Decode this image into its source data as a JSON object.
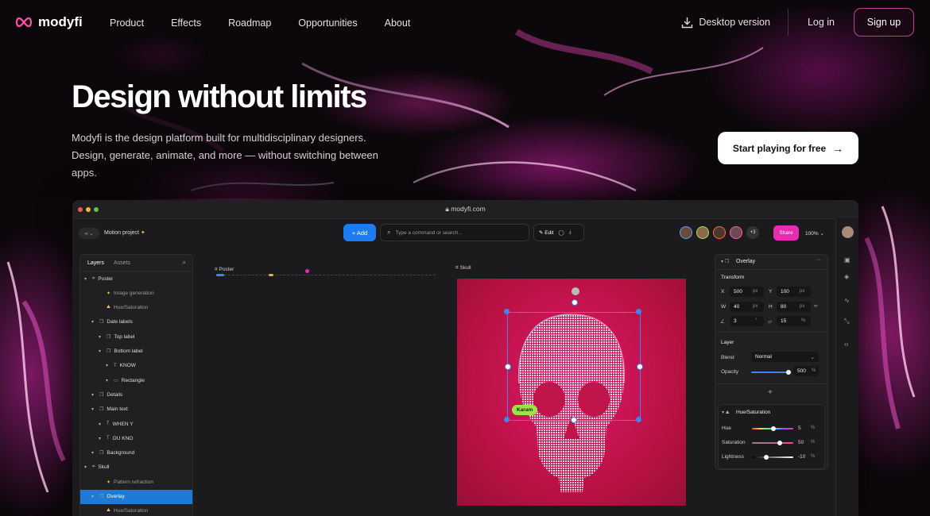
{
  "nav": {
    "brand": "modyfi",
    "menu": [
      "Product",
      "Effects",
      "Roadmap",
      "Opportunities",
      "About"
    ],
    "desktop": "Desktop version",
    "login": "Log in",
    "signup": "Sign up"
  },
  "hero": {
    "title": "Design without limits",
    "subtitle": "Modyfi is the design platform built for multidisciplinary designers. Design, generate, animate, and more — without switching between apps.",
    "cta": "Start playing for free"
  },
  "app": {
    "url": "modyfi.com",
    "project": "Motion project",
    "add": "+ Add",
    "command_placeholder": "Type a command or search...",
    "edit": "Edit",
    "more_users": "+3",
    "share": "Share",
    "zoom": "100%",
    "tabs": [
      "Layers",
      "Assets"
    ],
    "layers": [
      {
        "label": "Poster",
        "indent": 0,
        "icon": "grid"
      },
      {
        "label": "Image generation",
        "indent": 2,
        "icon": "star",
        "dim": true
      },
      {
        "label": "Hue/Saturation",
        "indent": 2,
        "icon": "mountain",
        "dim": true
      },
      {
        "label": "Date labels",
        "indent": 1,
        "icon": "group"
      },
      {
        "label": "Top label",
        "indent": 2,
        "icon": "layers"
      },
      {
        "label": "Bottom label",
        "indent": 2,
        "icon": "layers"
      },
      {
        "label": "KNOW",
        "indent": 3,
        "icon": "text"
      },
      {
        "label": "Rectangle",
        "indent": 3,
        "icon": "rect"
      },
      {
        "label": "Details",
        "indent": 1,
        "icon": "group"
      },
      {
        "label": "Main text",
        "indent": 1,
        "icon": "layers"
      },
      {
        "label": "WHEN Y",
        "indent": 2,
        "icon": "text"
      },
      {
        "label": "OU KNO",
        "indent": 2,
        "icon": "text"
      },
      {
        "label": "Background",
        "indent": 1,
        "icon": "layers"
      },
      {
        "label": "Skull",
        "indent": 0,
        "icon": "grid"
      },
      {
        "label": "Pattern refraction",
        "indent": 2,
        "icon": "star",
        "dim": true
      },
      {
        "label": "Overlay",
        "indent": 1,
        "icon": "layers",
        "selected": true
      },
      {
        "label": "Hue/Saturation",
        "indent": 2,
        "icon": "mountain",
        "dim": true
      }
    ],
    "canvas": {
      "poster_label": "Poster",
      "skull_label": "Skull",
      "cursor_name": "Karam"
    },
    "props": {
      "title": "Overlay",
      "transform": "Transform",
      "x_label": "X",
      "x": "500",
      "y_label": "Y",
      "y": "100",
      "w_label": "W",
      "w": "40",
      "h_label": "H",
      "h": "80",
      "rot": "3",
      "rot_unit": "°",
      "radius": "15",
      "radius_unit": "%",
      "px": "px",
      "layer": "Layer",
      "blend_label": "Blend",
      "blend": "Normal",
      "opacity_label": "Opacity",
      "opacity": "500",
      "pct": "%",
      "add": "+",
      "hs_title": "Hue/Saturation",
      "hue_label": "Hue",
      "hue": "5",
      "sat_label": "Saturation",
      "sat": "50",
      "light_label": "Lightness",
      "light": "-10"
    }
  }
}
